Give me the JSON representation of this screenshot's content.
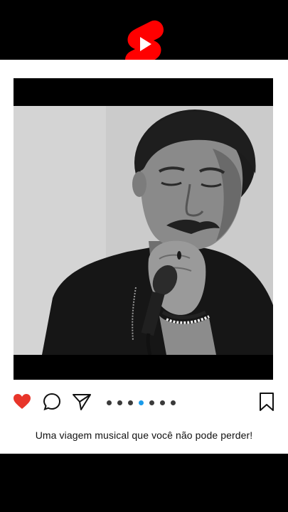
{
  "logo": {
    "icon": "youtube-shorts-logo",
    "color": "#ff0000"
  },
  "post": {
    "photo_description_icon": "man-singing-into-microphone",
    "actions": {
      "like_icon": "heart-icon",
      "like_color": "#e8352a",
      "comment_icon": "comment-icon",
      "share_icon": "send-icon",
      "bookmark_icon": "bookmark-icon"
    },
    "carousel": {
      "total": 7,
      "active_index": 3,
      "active_color": "#1a9bea"
    },
    "caption": "Uma viagem musical que você não pode perder!"
  }
}
